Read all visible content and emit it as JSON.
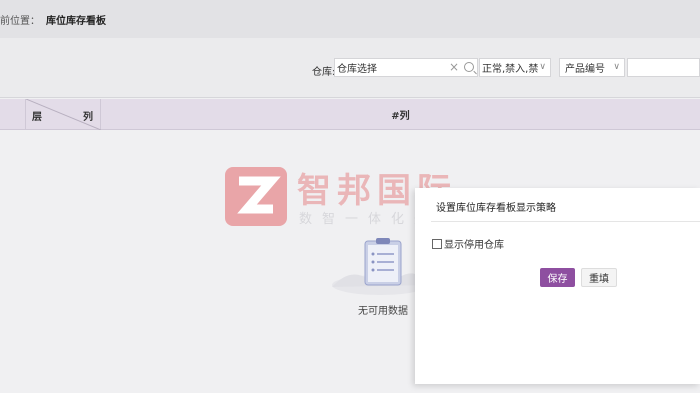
{
  "breadcrumb": {
    "prefix": "前位置：",
    "current": "库位库存看板"
  },
  "filters": {
    "warehouse_label": "仓库:",
    "warehouse_value": "仓库选择",
    "status_value": "正常,禁入,禁",
    "product_field": "产品编号"
  },
  "table": {
    "corner_row_label": "层",
    "corner_col_label": "列",
    "col_header": "#列"
  },
  "watermark": {
    "title": "智邦国际",
    "slogan": "数智一体化先行者"
  },
  "empty_state": {
    "text": "无可用数据"
  },
  "dialog": {
    "title": "设置库位库存看板显示策略",
    "checkbox_label": "显示停用仓库",
    "checkbox_checked": false,
    "save_label": "保存",
    "reset_label": "重填"
  },
  "colors": {
    "accent": "#8e4fa0",
    "header_bg": "#e3dce8",
    "watermark": "#e9a5a8"
  }
}
